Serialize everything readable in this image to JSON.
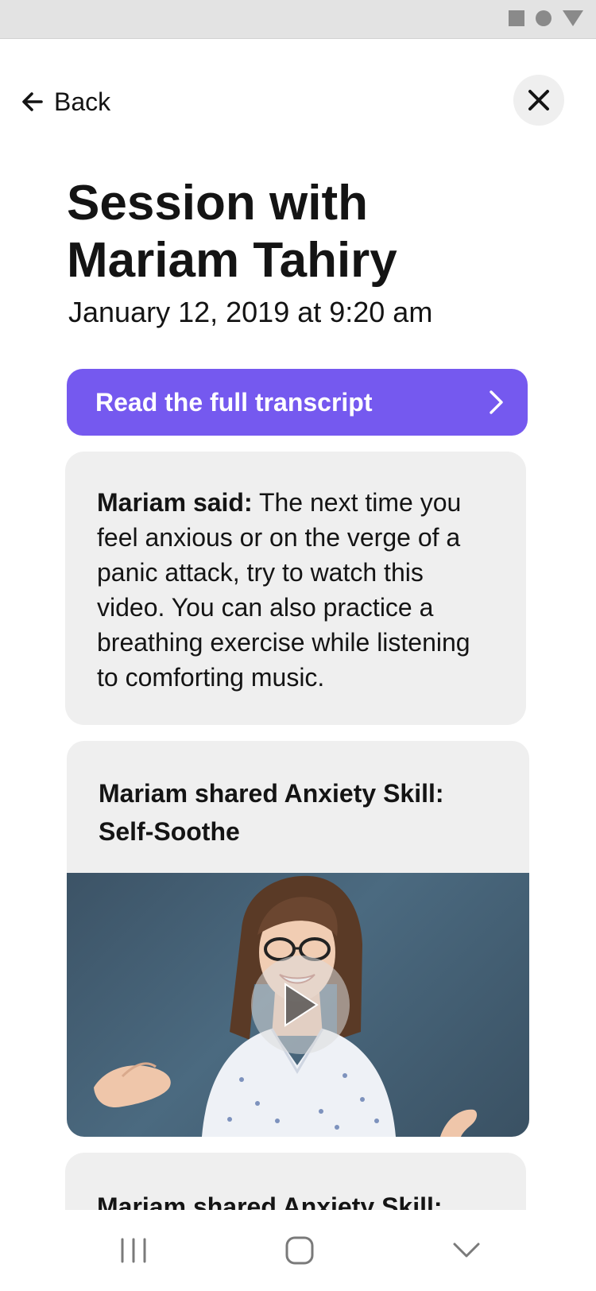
{
  "nav": {
    "back_label": "Back"
  },
  "session": {
    "title": "Session with Mariam Tahiry",
    "date": "January 12, 2019 at 9:20 am"
  },
  "transcript_button": {
    "label": "Read the full transcript"
  },
  "message": {
    "speaker": "Mariam said:",
    "text": "The next time you feel anxious or on the verge of a panic attack, try to watch this video. You can also practice a breathing exercise while listening to comforting music."
  },
  "skill_cards": [
    {
      "title": "Mariam shared Anxiety Skill: Self-Soothe"
    },
    {
      "title": "Mariam shared Anxiety Skill:"
    }
  ],
  "colors": {
    "accent": "#7559ef",
    "card": "#efefef",
    "text": "#141414"
  },
  "icons": {
    "back": "arrow-left-icon",
    "close": "close-icon",
    "chevron": "chevron-right-icon",
    "play": "play-icon",
    "nav_recent": "recent-apps-icon",
    "nav_home": "home-icon",
    "nav_back": "nav-back-chevron-icon"
  }
}
